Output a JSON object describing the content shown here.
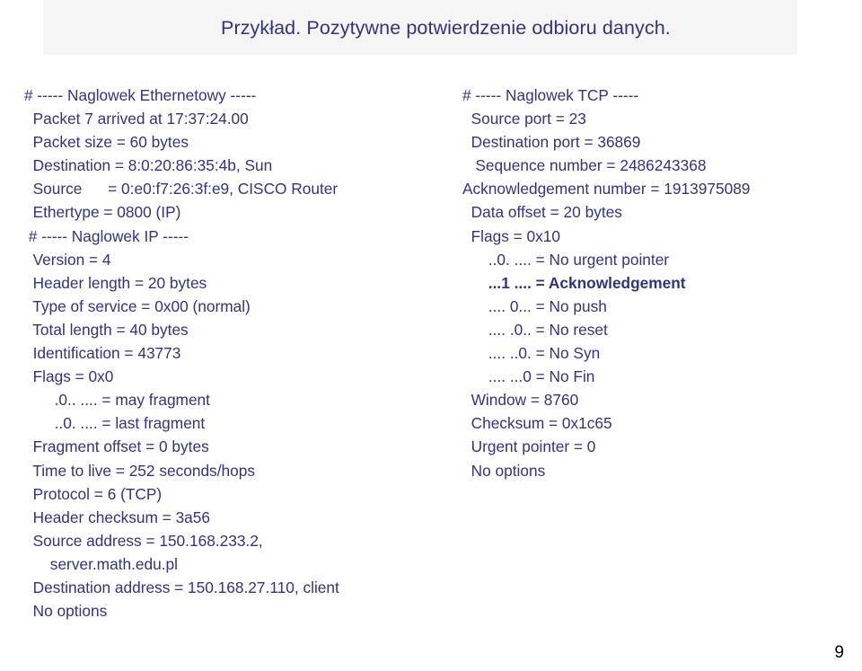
{
  "slide": {
    "title": "Przykład. Pozytywne potwierdzenie odbioru danych.",
    "page_number": "9",
    "colors": {
      "text": "#33337f",
      "title_band_background": "#f5f5f5",
      "page_number": "#000000",
      "background": "#ffffff"
    }
  },
  "left_column": {
    "lines": [
      {
        "text": "# ----- Naglowek Ethernetowy -----",
        "bold": false
      },
      {
        "text": "  Packet 7 arrived at 17:37:24.00",
        "bold": false
      },
      {
        "text": "  Packet size = 60 bytes",
        "bold": false
      },
      {
        "text": "  Destination = 8:0:20:86:35:4b, Sun",
        "bold": false
      },
      {
        "text": "  Source      = 0:e0:f7:26:3f:e9, CISCO Router",
        "bold": false
      },
      {
        "text": "  Ethertype = 0800 (IP)",
        "bold": false
      },
      {
        "text": " # ----- Naglowek IP -----",
        "bold": false
      },
      {
        "text": "  Version = 4",
        "bold": false
      },
      {
        "text": "  Header length = 20 bytes",
        "bold": false
      },
      {
        "text": "  Type of service = 0x00 (normal)",
        "bold": false
      },
      {
        "text": "  Total length = 40 bytes",
        "bold": false
      },
      {
        "text": "  Identification = 43773",
        "bold": false
      },
      {
        "text": "  Flags = 0x0",
        "bold": false
      },
      {
        "text": "       .0.. .... = may fragment",
        "bold": false
      },
      {
        "text": "       ..0. .... = last fragment",
        "bold": false
      },
      {
        "text": "  Fragment offset = 0 bytes",
        "bold": false
      },
      {
        "text": "  Time to live = 252 seconds/hops",
        "bold": false
      },
      {
        "text": "  Protocol = 6 (TCP)",
        "bold": false
      },
      {
        "text": "  Header checksum = 3a56",
        "bold": false
      },
      {
        "text": "  Source address = 150.168.233.2,",
        "bold": false
      },
      {
        "text": "      server.math.edu.pl",
        "bold": false
      },
      {
        "text": "  Destination address = 150.168.27.110, client",
        "bold": false
      },
      {
        "text": "  No options",
        "bold": false
      }
    ]
  },
  "right_column": {
    "lines": [
      {
        "text": "# ----- Naglowek TCP -----",
        "bold": false
      },
      {
        "text": "  Source port = 23",
        "bold": false
      },
      {
        "text": "  Destination port = 36869",
        "bold": false
      },
      {
        "text": "   Sequence number = 2486243368",
        "bold": false
      },
      {
        "text": "Acknowledgement number = 1913975089",
        "bold": false
      },
      {
        "text": "  Data offset = 20 bytes",
        "bold": false
      },
      {
        "text": "  Flags = 0x10",
        "bold": false
      },
      {
        "text": "      ..0. .... = No urgent pointer",
        "bold": false
      },
      {
        "text": "      ...1 .... = Acknowledgement",
        "bold": true
      },
      {
        "text": "      .... 0... = No push",
        "bold": false
      },
      {
        "text": "      .... .0.. = No reset",
        "bold": false
      },
      {
        "text": "      .... ..0. = No Syn",
        "bold": false
      },
      {
        "text": "      .... ...0 = No Fin",
        "bold": false
      },
      {
        "text": "  Window = 8760",
        "bold": false
      },
      {
        "text": "  Checksum = 0x1c65",
        "bold": false
      },
      {
        "text": "  Urgent pointer = 0",
        "bold": false
      },
      {
        "text": "  No options",
        "bold": false
      }
    ]
  }
}
